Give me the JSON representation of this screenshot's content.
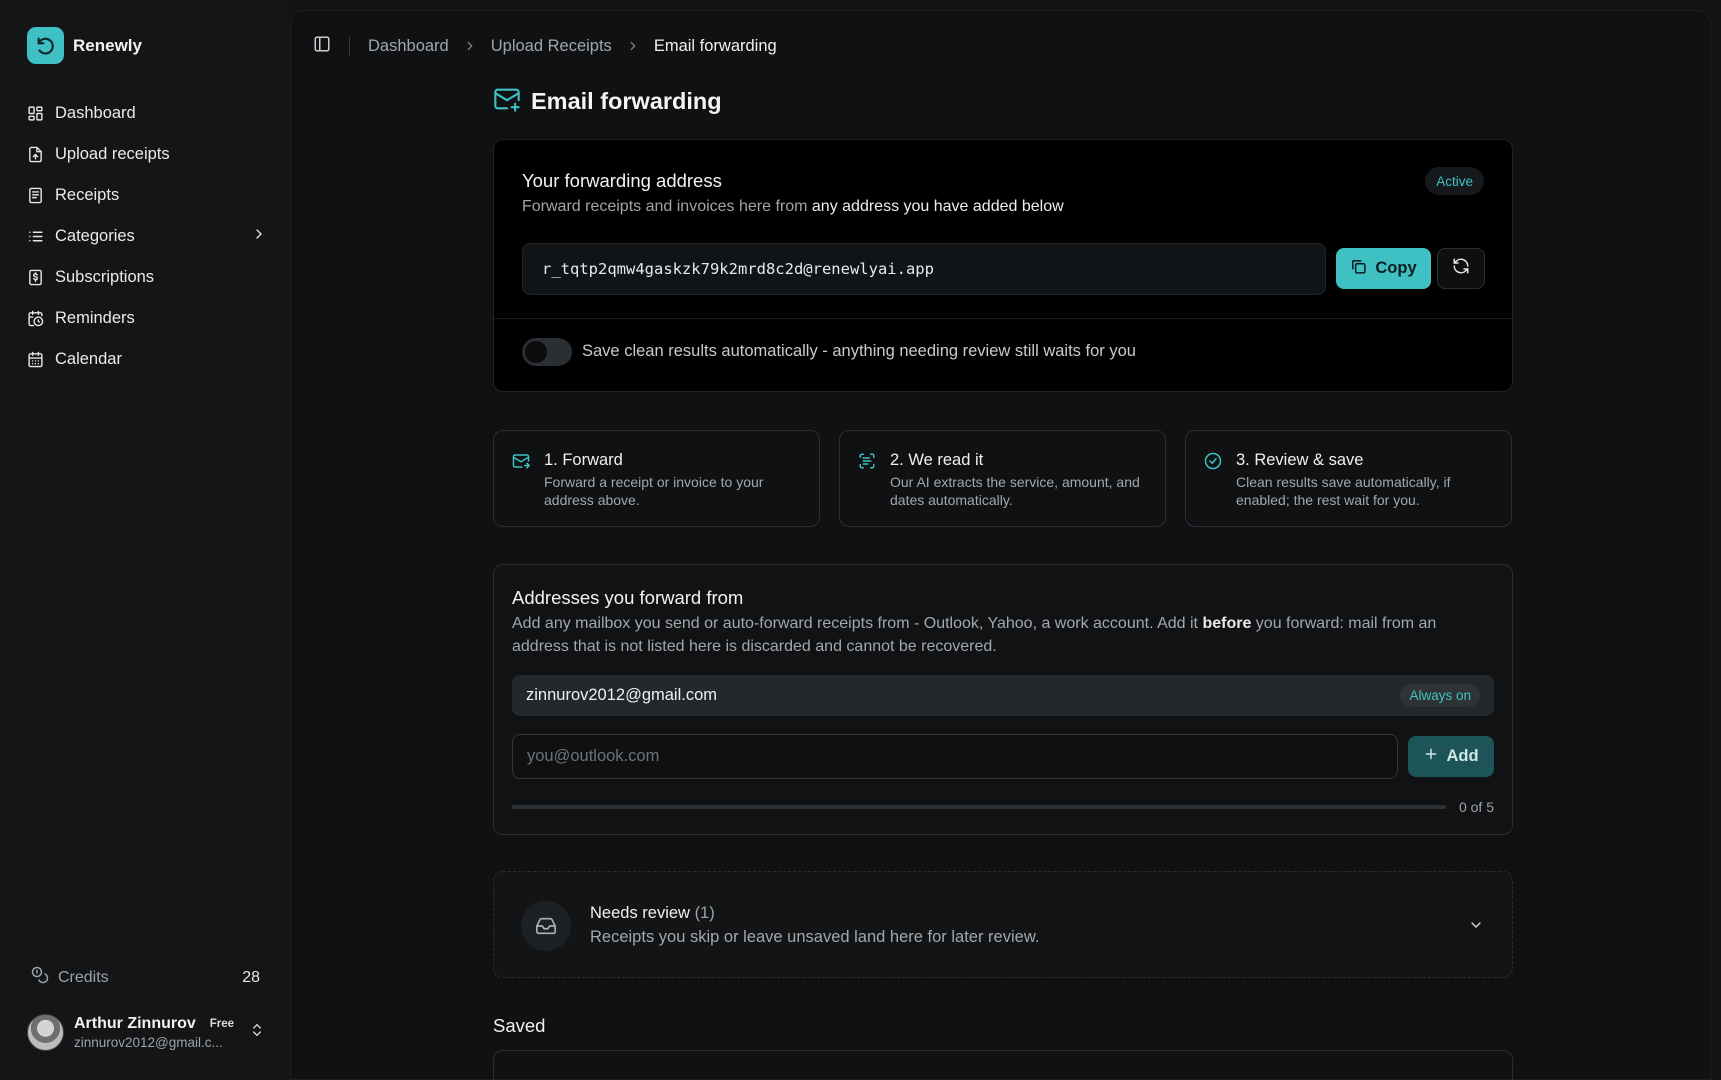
{
  "brand": {
    "name": "Renewly",
    "accent": "#3fc1c4"
  },
  "sidebar": {
    "items": [
      {
        "label": "Dashboard",
        "icon": "dashboard-icon"
      },
      {
        "label": "Upload receipts",
        "icon": "file-upload-icon"
      },
      {
        "label": "Receipts",
        "icon": "receipt-icon"
      },
      {
        "label": "Categories",
        "icon": "list-icon"
      },
      {
        "label": "Subscriptions",
        "icon": "dollar-file-icon"
      },
      {
        "label": "Reminders",
        "icon": "calendar-clock-icon"
      },
      {
        "label": "Calendar",
        "icon": "calendar-icon"
      }
    ],
    "credits_label": "Credits",
    "credits_count": "28",
    "user": {
      "name": "Arthur Zinnurov",
      "plan": "Free",
      "email": "zinnurov2012@gmail.c..."
    }
  },
  "breadcrumb": [
    "Dashboard",
    "Upload Receipts",
    "Email forwarding"
  ],
  "page": {
    "title": "Email forwarding"
  },
  "forwarding": {
    "title": "Your forwarding address",
    "subtitle_prefix": "Forward receipts and invoices here from ",
    "subtitle_bold": "any address you have added below",
    "status": "Active",
    "address": "r_tqtp2qmw4gaskzk79k2mrd8c2d@renewlyai.app",
    "copy_label": "Copy",
    "toggle_label": "Save clean results automatically - anything needing review still waits for you",
    "toggle_on": false
  },
  "steps": [
    {
      "title": "1. Forward",
      "desc": "Forward a receipt or invoice to your address above.",
      "icon": "mail-icon"
    },
    {
      "title": "2. We read it",
      "desc": "Our AI extracts the service, amount, and dates automatically.",
      "icon": "scan-text-icon"
    },
    {
      "title": "3. Review & save",
      "desc": "Clean results save automatically, if enabled; the rest wait for you.",
      "icon": "check-circle-icon"
    }
  ],
  "senders": {
    "title": "Addresses you forward from",
    "desc_prefix": "Add any mailbox you send or auto-forward receipts from - Outlook, Yahoo, a work account. Add it ",
    "desc_bold": "before",
    "desc_suffix": " you forward: mail from an address that is not listed here is discarded and cannot be recovered.",
    "primary_email": "zinnurov2012@gmail.com",
    "primary_badge": "Always on",
    "input_placeholder": "you@outlook.com",
    "add_label": "Add",
    "usage_label": "0 of 5",
    "usage_fraction": 0
  },
  "needs_review": {
    "title": "Needs review",
    "count": "(1)",
    "subtitle": "Receipts you skip or leave unsaved land here for later review."
  },
  "saved": {
    "title": "Saved"
  }
}
